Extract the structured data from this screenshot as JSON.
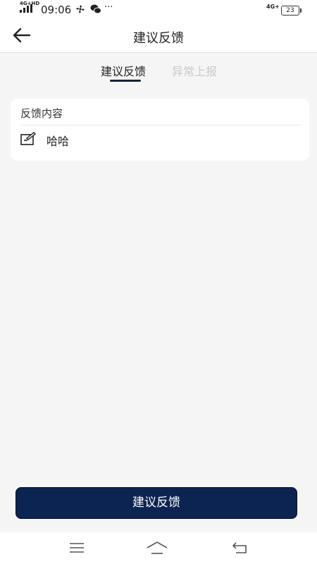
{
  "status_bar": {
    "network_left": "4G+HD",
    "time": "09:06",
    "more": "···",
    "network_right": "4G+",
    "battery": "23"
  },
  "header": {
    "title": "建议反馈"
  },
  "tabs": [
    {
      "label": "建议反馈",
      "active": true
    },
    {
      "label": "异常上报",
      "active": false
    }
  ],
  "feedback_card": {
    "label": "反馈内容",
    "value": "哈哈"
  },
  "submit_button": {
    "label": "建议反馈"
  },
  "colors": {
    "primary": "#0b2452",
    "background": "#f5f5f5",
    "inactive_tab": "#c9c9c9"
  }
}
